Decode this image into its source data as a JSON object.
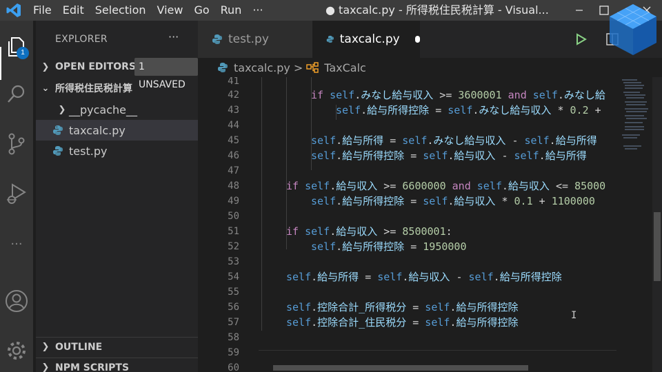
{
  "menu": [
    "File",
    "Edit",
    "Selection",
    "View",
    "Go",
    "Run",
    "···"
  ],
  "window_title": "● taxcalc.py - 所得税住民税計算 - Visual...",
  "activity": {
    "badge_count": "1",
    "more": "···"
  },
  "sidebar": {
    "title": "EXPLORER",
    "more": "···",
    "open_editors": "OPEN EDITORS",
    "unsaved_badge": "1 UNSAVED",
    "folder": "所得税住民税計算",
    "items": [
      {
        "label": "__pycache__",
        "type": "folder"
      },
      {
        "label": "taxcalc.py",
        "type": "python"
      },
      {
        "label": "test.py",
        "type": "python"
      }
    ],
    "outline": "OUTLINE",
    "npm_scripts": "NPM SCRIPTS"
  },
  "tabs": [
    {
      "label": "test.py",
      "active": false
    },
    {
      "label": "taxcalc.py",
      "active": true,
      "unsaved": true
    }
  ],
  "breadcrumb": {
    "file": "taxcalc.py",
    "separator": ">",
    "symbol": "TaxCalc"
  },
  "code": {
    "line_numbers": [
      "41",
      "42",
      "43",
      "44",
      "45",
      "46",
      "47",
      "48",
      "49",
      "50",
      "51",
      "52",
      "53",
      "54",
      "55",
      "56",
      "57",
      "58",
      "59",
      "60"
    ],
    "lines": {
      "l42": "if self.みなし給与収入 >= 3600001 and self.みなし給",
      "l43": "self.給与所得控除 = self.みなし給与収入 * 0.2 +",
      "l45": "self.給与所得 = self.みなし給与収入 - self.給与所得",
      "l46": "self.給与所得控除 = self.給与収入 - self.給与所得",
      "l48": "if self.給与収入 >= 6600000 and self.給与収入 <= 85000",
      "l49": "self.給与所得控除 = self.給与収入 * 0.1 + 1100000",
      "l51": "if self.給与収入 >= 8500001:",
      "l52": "self.給与所得控除 = 1950000",
      "l54": "self.給与所得 = self.給与収入 - self.給与所得控除",
      "l56": "self.控除合計_所得税分 = self.給与所得控除",
      "l57": "self.控除合計_住民税分 = self.給与所得控除"
    }
  },
  "colors": {
    "keyword": "#c586c0",
    "self": "#569cd6",
    "variable": "#9cdcfe",
    "number": "#b5cea8",
    "run": "#89d185",
    "python": "#519aba"
  }
}
